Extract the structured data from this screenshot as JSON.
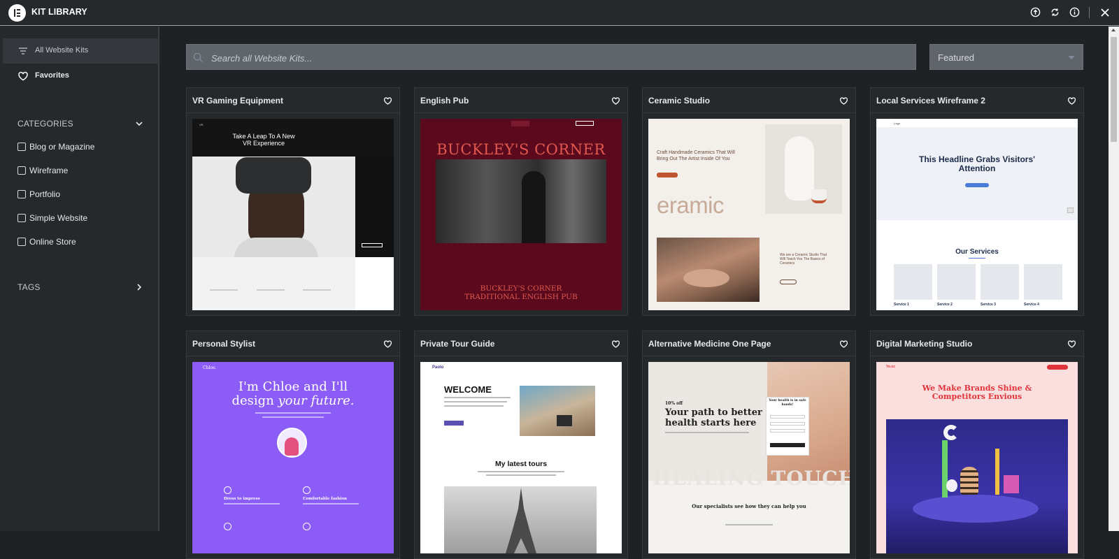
{
  "app": {
    "title": "KIT LIBRARY"
  },
  "topbar_icons": [
    "upload-icon",
    "sync-icon",
    "info-icon",
    "close-icon"
  ],
  "sidebar": {
    "all_kits": "All Website Kits",
    "favorites": "Favorites",
    "categories_label": "CATEGORIES",
    "categories": [
      "Blog or Magazine",
      "Wireframe",
      "Portfolio",
      "Simple Website",
      "Online Store"
    ],
    "tags_label": "TAGS"
  },
  "search": {
    "placeholder": "Search all Website Kits..."
  },
  "sort": {
    "selected": "Featured"
  },
  "kits": [
    {
      "title": "VR Gaming Equipment",
      "preview": {
        "headline": "Take A Leap To A New VR Experience",
        "logo": "VR"
      }
    },
    {
      "title": "English Pub",
      "preview": {
        "headline": "BUCKLEY'S CORNER",
        "footer_line1": "BUCKLEY'S CORNER",
        "footer_line2": "TRADITIONAL ENGLISH PUB"
      }
    },
    {
      "title": "Ceramic Studio",
      "preview": {
        "headline": "Craft Handmade Ceramics That Will Bring Out The Artist Inside Of You",
        "big_word": "eramic",
        "side_text": "We are a Ceramic Studio That Will Teach You The Basics of Ceramics"
      }
    },
    {
      "title": "Local Services Wireframe 2",
      "preview": {
        "logo": "Logo",
        "headline": "This Headline Grabs Visitors' Attention",
        "section_title": "Our Services",
        "services": [
          "Service 1",
          "Service 2",
          "Service 3",
          "Service 4"
        ]
      }
    },
    {
      "title": "Personal Stylist",
      "preview": {
        "logo": "Chloe.",
        "headline_line1": "I'm Chloe and I'll",
        "headline_line2a": "design ",
        "headline_line2b": "your future.",
        "feature1": "Dress to impress",
        "feature2": "Comfortable fashion"
      }
    },
    {
      "title": "Private Tour Guide",
      "preview": {
        "logo": "Paolo",
        "headline": "WELCOME",
        "section_title": "My latest tours"
      }
    },
    {
      "title": "Alternative Medicine One Page",
      "preview": {
        "promo": "10% off",
        "headline": "Your path to better health starts here",
        "form_title": "Your health is in safe hands!",
        "big_word": "HEALING TOUCH",
        "section_title": "Our specialists see how they can help you"
      }
    },
    {
      "title": "Digital Marketing Studio",
      "preview": {
        "logo": "Yo.sc",
        "headline": "We Make Brands Shine & Competitors Envious"
      }
    }
  ]
}
